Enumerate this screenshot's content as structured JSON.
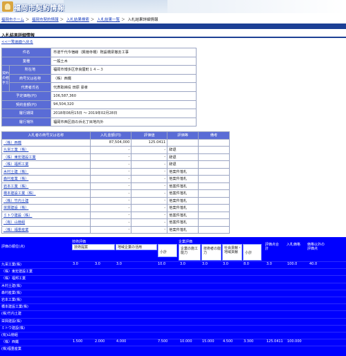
{
  "header": {
    "logo_text": "福岡市契約情報"
  },
  "breadcrumb": [
    "福岡市ホーム",
    "福岡市契約情報",
    "入札結果検索",
    "入札結果一覧",
    "入札結果詳細情報"
  ],
  "section_title": "入札結果詳細情報",
  "back_link": "<<一覧画面へ戻る",
  "info": {
    "rows": [
      {
        "label": "件名",
        "value": "市道千代今宿線（興徳寺橋）既設橋梁撤去工事"
      },
      {
        "label": "業種",
        "value": "一般土木"
      },
      {
        "label": "所在地",
        "value": "福岡市博多区奈良屋町１４－３"
      },
      {
        "label": "商号又は名称",
        "value": "（株）西鐵"
      },
      {
        "label": "代表者氏名",
        "value": "代表取締役 田原 豪孝"
      },
      {
        "label": "予定価格(円)",
        "value": "106,587,360"
      },
      {
        "label": "契約金額(円)",
        "value": "94,504,320"
      },
      {
        "label": "履行期間",
        "value": "2018年08月15日 ～ 2019年02月28日"
      },
      {
        "label": "履行場所",
        "value": "福岡市西区前の浜北丁目地内外"
      }
    ],
    "group_label": "契約の相手方"
  },
  "bid_table": {
    "headers": [
      "入札者の商号又は名称",
      "入札金額(円)",
      "評価値",
      "評価等",
      "備考"
    ],
    "rows": [
      {
        "name": "（株）西鐵",
        "amount": "87,504,000",
        "score": "125.0411",
        "status": "",
        "note": ""
      },
      {
        "name": "九栄工業（株）",
        "amount": "-",
        "score": "-",
        "status": "辞退",
        "note": ""
      },
      {
        "name": "（株）東宏建設工業",
        "amount": "-",
        "score": "-",
        "status": "辞退",
        "note": ""
      },
      {
        "name": "（株）福邦工業",
        "amount": "-",
        "score": "-",
        "status": "辞退",
        "note": ""
      },
      {
        "name": "木村土建（株）",
        "amount": "-",
        "score": "-",
        "status": "他案件落札",
        "note": ""
      },
      {
        "name": "森村産業（株）",
        "amount": "-",
        "score": "-",
        "status": "他案件落札",
        "note": ""
      },
      {
        "name": "岩本工業（株）",
        "amount": "-",
        "score": "-",
        "status": "他案件落札",
        "note": ""
      },
      {
        "name": "橋本建設工業（株）",
        "amount": "-",
        "score": "-",
        "status": "他案件落札",
        "note": ""
      },
      {
        "name": "（株）竹内土建",
        "amount": "-",
        "score": "-",
        "status": "他案件落札",
        "note": ""
      },
      {
        "name": "栄興建設（株）",
        "amount": "-",
        "score": "-",
        "status": "他案件落札",
        "note": ""
      },
      {
        "name": "ミトウ建設（株）",
        "amount": "-",
        "score": "-",
        "status": "他案件落札",
        "note": ""
      },
      {
        "name": "（有）山徳組",
        "amount": "-",
        "score": "-",
        "status": "他案件落札",
        "note": ""
      },
      {
        "name": "（株）福重産業",
        "amount": "-",
        "score": "-",
        "status": "他案件落札",
        "note": ""
      }
    ]
  },
  "eval": {
    "top_label_1": "技術評価",
    "top_label_2": "企業評価",
    "col_a": "技術提案",
    "col_b": "地域企業の活用",
    "col_c": "小計",
    "col_d": "企業の施工能力",
    "col_e": "技術者の能力",
    "col_f": "社会貢献・地域貢献",
    "col_g": "小計",
    "col_h": "評価点合計",
    "col_i": "入札価格",
    "col_j": "価格以外の評価点",
    "left_head": "評価の順位(点)",
    "first_row": "九栄工業(株)",
    "first_values": [
      "3.0",
      "3.0",
      "3.0",
      "10.0",
      "3.0",
      "3.0",
      "3.0",
      "8.0",
      "3.0",
      "100.0",
      "40.0"
    ],
    "names": [
      "九栄工業(株)",
      "（株）東宏建設工業",
      "（株）福邦工業",
      "木村土建(株)",
      "森村産業(株)",
      "岩本工業(株)",
      "橋本建設工業(株)",
      "(株)竹内土建",
      "栄興建設(株)",
      "ミトウ建設(株)",
      "(有)山徳組",
      "（株）西鐵",
      "(株)福重産業"
    ],
    "bottom_values": [
      "1.500",
      "2.000",
      "4.000",
      "7.500",
      "10.000",
      "15.000",
      "4.500",
      "3.300",
      "125.0411",
      "100.000"
    ]
  }
}
